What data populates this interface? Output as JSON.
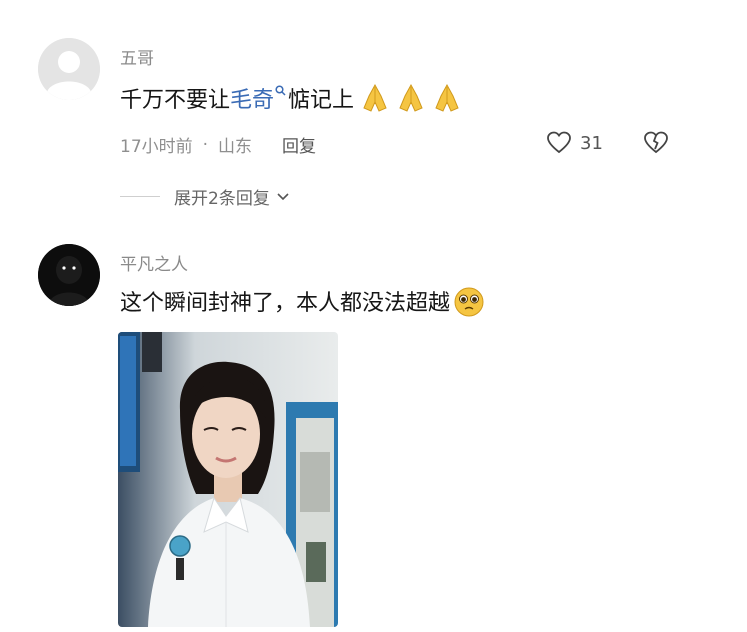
{
  "comments": [
    {
      "username": "五哥",
      "text_before": "千万不要让",
      "link_text": "毛奇",
      "text_after": "惦记上",
      "emoji": [
        "praying-hands",
        "praying-hands",
        "praying-hands"
      ],
      "time": "17小时前",
      "location": "山东",
      "reply_label": "回复",
      "like_count": "31",
      "expand_label": "展开2条回复"
    },
    {
      "username": "平凡之人",
      "text": "这个瞬间封神了，本人都没法超越",
      "emoji": [
        "pleading-face"
      ],
      "image": "photo of a young woman in a white uniform"
    }
  ],
  "icons": {
    "magnifier": "🔍",
    "like": "heart-icon",
    "dislike": "broken-heart-icon",
    "chevron": "chevron-down-icon"
  },
  "colors": {
    "link": "#3a6bb5",
    "meta": "#8f8f8f",
    "emoji_yellow": "#f5c542"
  }
}
